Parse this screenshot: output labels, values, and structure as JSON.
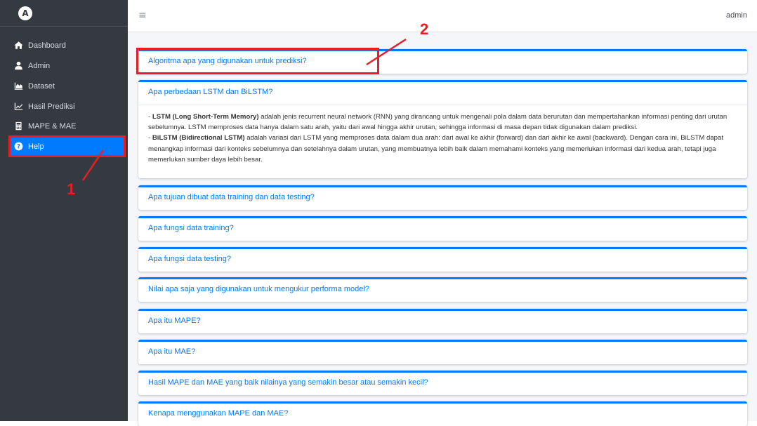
{
  "sidebar": {
    "logo_glyph": "A",
    "items": [
      {
        "label": "Dashboard",
        "icon": "home-icon",
        "active": false
      },
      {
        "label": "Admin",
        "icon": "user-icon",
        "active": false
      },
      {
        "label": "Dataset",
        "icon": "chart-area-icon",
        "active": false
      },
      {
        "label": "Hasil Prediksi",
        "icon": "chart-line-icon",
        "active": false
      },
      {
        "label": "MAPE & MAE",
        "icon": "calculator-icon",
        "active": false
      },
      {
        "label": "Help",
        "icon": "question-circle-icon",
        "active": true
      }
    ]
  },
  "header": {
    "menu_glyph": "≡",
    "user_label": "admin"
  },
  "faq": [
    {
      "question": "Algoritma apa yang digunakan untuk prediksi?"
    },
    {
      "question": "Apa perbedaan LSTM dan BiLSTM?",
      "answer": {
        "lstm_term": "LSTM (Long Short-Term Memory)",
        "lstm_text": " adalah jenis recurrent neural network (RNN) yang dirancang untuk mengenali pola dalam data berurutan dan mempertahankan informasi penting dari urutan sebelumnya. LSTM memproses data hanya dalam satu arah, yaitu dari awal hingga akhir urutan, sehingga informasi di masa depan tidak digunakan dalam prediksi.",
        "bilstm_term": "BiLSTM (Bidirectional LSTM)",
        "bilstm_text": " adalah variasi dari LSTM yang memproses data dalam dua arah: dari awal ke akhir (forward) dan dari akhir ke awal (backward). Dengan cara ini, BiLSTM dapat menangkap informasi dari konteks sebelumnya dan setelahnya dalam urutan, yang membuatnya lebih baik dalam memahami konteks yang memerlukan informasi dari kedua arah, tetapi juga memerlukan sumber daya lebih besar."
      }
    },
    {
      "question": "Apa tujuan dibuat data training dan data testing?"
    },
    {
      "question": "Apa fungsi data training?"
    },
    {
      "question": "Apa fungsi data testing?"
    },
    {
      "question": "Nilai apa saja yang digunakan untuk mengukur performa model?"
    },
    {
      "question": "Apa itu MAPE?"
    },
    {
      "question": "Apa itu MAE?"
    },
    {
      "question": "Hasil MAPE dan MAE yang baik nilainya yang semakin besar atau semakin kecil?"
    },
    {
      "question": "Kenapa menggunakan MAPE dan MAE?"
    }
  ],
  "annotations": {
    "label_1": "1",
    "label_2": "2",
    "color": "#e81e25"
  },
  "colors": {
    "sidebar_bg": "#343a40",
    "accent": "#007bff",
    "content_bg": "#f4f6f9"
  }
}
